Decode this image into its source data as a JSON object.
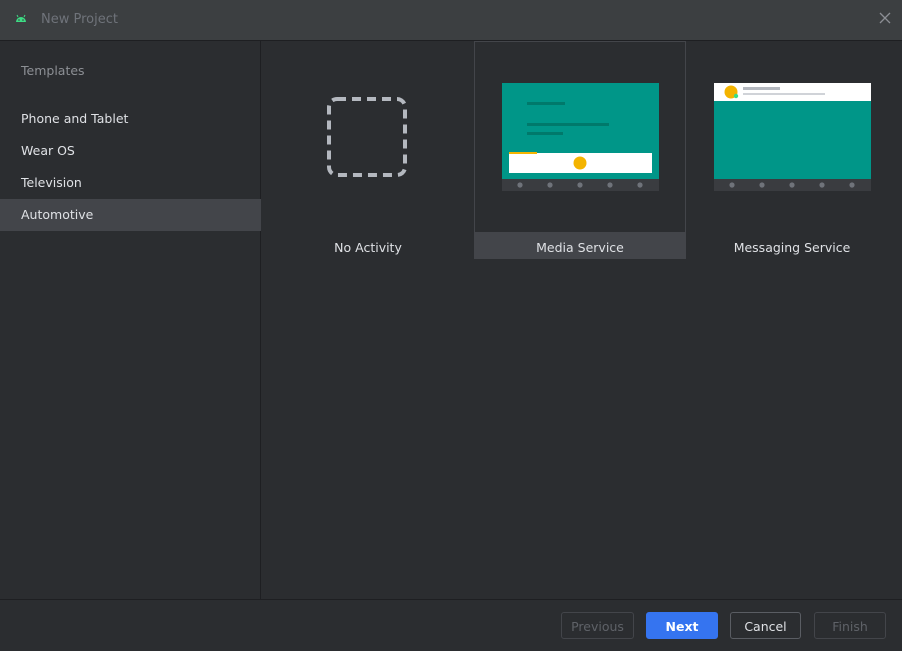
{
  "window": {
    "title": "New Project",
    "icon": "android-icon",
    "close_icon": "close-icon"
  },
  "sidebar": {
    "section_label": "Templates",
    "items": [
      {
        "label": "Phone and Tablet",
        "selected": false
      },
      {
        "label": "Wear OS",
        "selected": false
      },
      {
        "label": "Television",
        "selected": false
      },
      {
        "label": "Automotive",
        "selected": true
      }
    ]
  },
  "templates": [
    {
      "label": "No Activity",
      "selected": false,
      "thumbnail": "dashed-placeholder"
    },
    {
      "label": "Media Service",
      "selected": true,
      "thumbnail": "media-service-preview"
    },
    {
      "label": "Messaging Service",
      "selected": false,
      "thumbnail": "messaging-service-preview"
    }
  ],
  "footer": {
    "previous_label": "Previous",
    "next_label": "Next",
    "cancel_label": "Cancel",
    "finish_label": "Finish"
  },
  "colors": {
    "background": "#2b2d30",
    "selected": "#43454a",
    "accent": "#3574f0",
    "teal": "#009688",
    "yellow": "#f4b400",
    "android_green": "#3ddc84"
  }
}
